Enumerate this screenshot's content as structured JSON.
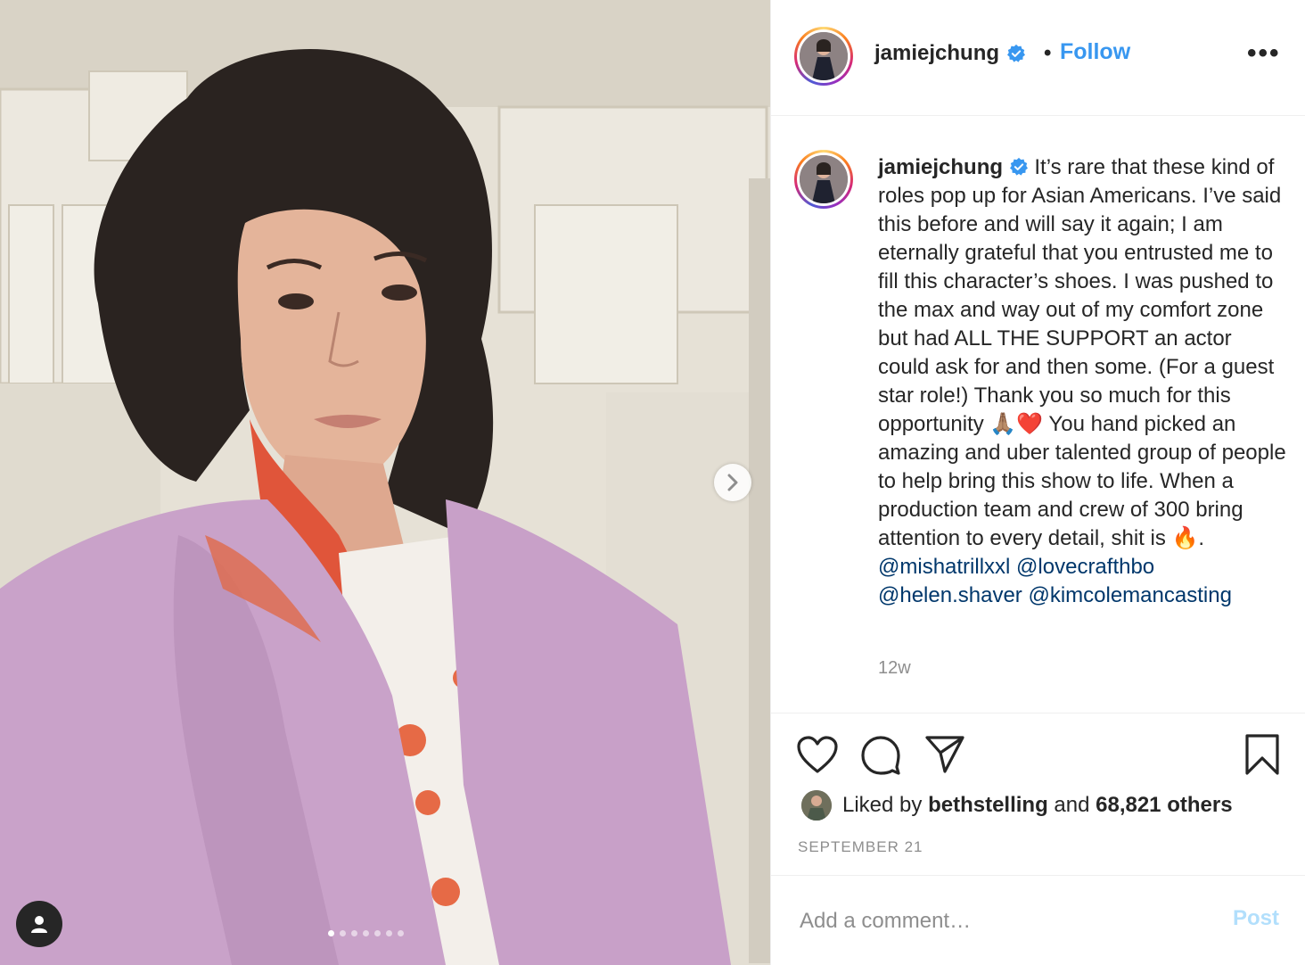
{
  "post": {
    "username": "jamiejchung",
    "follow_sep": "•",
    "follow_label": "Follow",
    "more_label": "•••",
    "caption_text_1": " It’s rare that these kind of roles pop up for Asian Americans. I’ve said this before and will say it again; I am eternally grateful that you entrusted me to fill this character’s shoes. I was pushed to the max and way out of my comfort zone but had ALL THE SUPPORT an actor could ask for and then some. (For a guest star role!) Thank you so much for this opportunity ",
    "caption_emoji_1": "🙏🏽❤️",
    "caption_text_2": " You hand picked an amazing and uber talented group of people to help bring this show to life. When a production team and crew of 300 bring attention to every detail, shit is ",
    "caption_emoji_2": "🔥",
    "caption_text_3": ". ",
    "mentions": [
      "@mishatrillxxl",
      "@lovecrafthbo",
      "@helen.shaver",
      "@kimcolemancasting"
    ],
    "time_ago": "12w",
    "liked_by_prefix": "Liked by",
    "liked_by_user": "bethstelling",
    "liked_by_and": "and",
    "liked_by_count": "68,821 others",
    "date": "SEPTEMBER 21"
  },
  "comment": {
    "placeholder": "Add a comment…",
    "post_label": "Post"
  },
  "carousel": {
    "total_slides": 7,
    "active_slide": 1
  },
  "colors": {
    "link_blue": "#3897f0",
    "mention_blue": "#00376b",
    "muted_gray": "#8e8e8e",
    "post_disabled": "#b2dffc"
  },
  "icons": {
    "verified": "verified-badge-icon",
    "like": "heart-icon",
    "comment": "comment-bubble-icon",
    "share": "paper-plane-icon",
    "save": "bookmark-icon",
    "next": "chevron-right-icon",
    "tag": "user-tag-icon"
  }
}
